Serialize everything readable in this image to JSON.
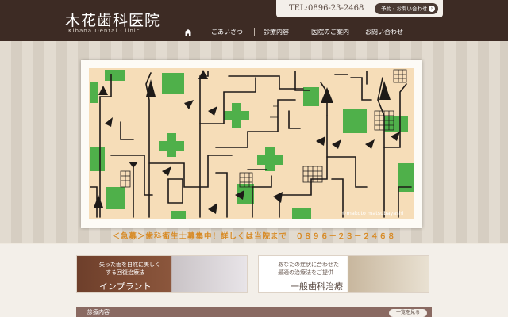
{
  "header": {
    "clinic_name": "木花歯科医院",
    "clinic_name_en": "Kibana Dental Clinic",
    "tel": "TEL:0896-23-2468",
    "contact_button": "予約・お問い合わせ"
  },
  "nav": {
    "items": [
      {
        "label": "ごあいさつ"
      },
      {
        "label": "診療内容"
      },
      {
        "label": "医院のご案内"
      },
      {
        "label": "お問い合わせ"
      }
    ]
  },
  "hero": {
    "credit": "©makoto matsubayashi"
  },
  "banner": {
    "text": "＜急募＞歯科衛生士募集中！詳しくは当院まで　０８９６－２３－２４６８"
  },
  "cards": {
    "implant": {
      "line1": "失った歯を自然に美しく",
      "line2": "する回復治療法",
      "title": "インプラント"
    },
    "general": {
      "line1": "あなたの症状に合わせた",
      "line2": "最適の治療法をご提供",
      "title": "一般歯科治療"
    }
  },
  "menu_section": {
    "title": "診療内容",
    "link": "一覧を見る"
  },
  "colors": {
    "header_bg": "#3d2b24",
    "banner_text": "#d88b26",
    "art_bg": "#f6ddb8",
    "art_green": "#4fb04a"
  }
}
